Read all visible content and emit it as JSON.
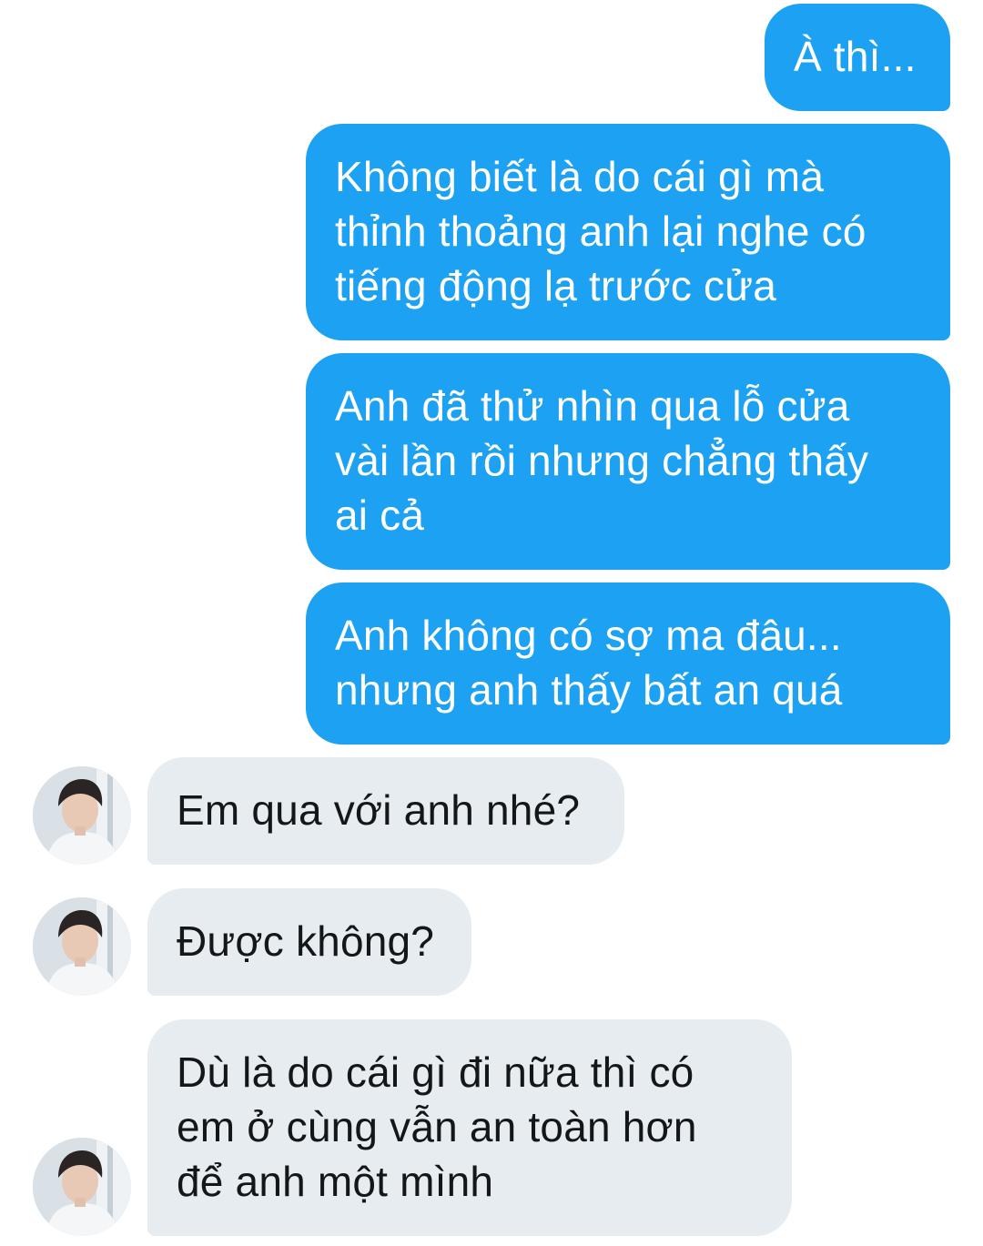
{
  "conversation": {
    "outgoing": [
      {
        "text": "À thì..."
      },
      {
        "text": "Không biết là do cái gì mà\nthỉnh thoảng anh lại nghe có\ntiếng động lạ trước cửa"
      },
      {
        "text": "Anh đã thử nhìn qua lỗ cửa\nvài lần rồi nhưng chẳng thấy\nai cả"
      },
      {
        "text": "Anh không có sợ ma đâu...\nnhưng anh thấy bất an quá"
      }
    ],
    "incoming": [
      {
        "text": "Em qua với anh nhé?"
      },
      {
        "text": "Được không?"
      },
      {
        "text": "Dù là do cái gì đi nữa thì có\nem ở cùng vẫn an toàn hơn\nđể anh một mình"
      }
    ]
  },
  "colors": {
    "outgoing_bubble": "#1da1f2",
    "incoming_bubble": "#e6ecf0",
    "outgoing_text": "#ffffff",
    "incoming_text": "#14171a"
  },
  "icons": {
    "avatar": "contact-avatar-photo"
  }
}
